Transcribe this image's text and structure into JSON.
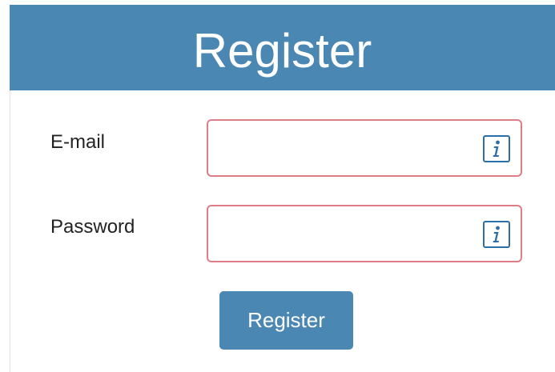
{
  "header": {
    "title": "Register"
  },
  "form": {
    "email": {
      "label": "E-mail",
      "value": "",
      "placeholder": "",
      "status_icon": "info-icon"
    },
    "password": {
      "label": "Password",
      "value": "",
      "placeholder": "",
      "status_icon": "info-icon"
    },
    "submit_label": "Register"
  },
  "colors": {
    "header_background": "#4a87b3",
    "button_background": "#4a87b3",
    "invalid_field_border": "#e07c86",
    "info_icon": "#2c6fa8"
  }
}
